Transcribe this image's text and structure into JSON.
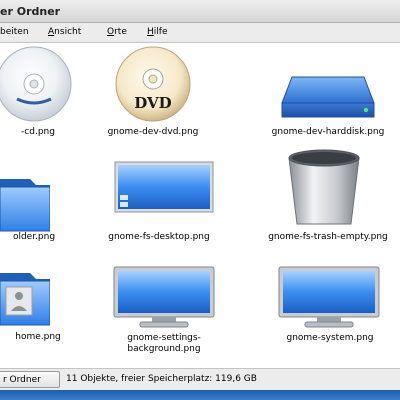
{
  "window": {
    "title": "er Ordner"
  },
  "menu": [
    {
      "label": "beiten",
      "underline": ""
    },
    {
      "label": "Ansicht",
      "underline": "A"
    },
    {
      "label": "Orte",
      "underline": "O"
    },
    {
      "label": "Hilfe",
      "underline": "H"
    }
  ],
  "files": [
    {
      "name": "-cd.png",
      "icon": "cd-disc-icon"
    },
    {
      "name": "gnome-dev-dvd.png",
      "icon": "dvd-disc-icon",
      "disc_text": "DVD"
    },
    {
      "name": "gnome-dev-harddisk.png",
      "icon": "harddisk-icon"
    },
    {
      "name": "older.png",
      "icon": "folder-icon"
    },
    {
      "name": "gnome-fs-desktop.png",
      "icon": "desktop-icon"
    },
    {
      "name": "gnome-fs-trash-empty.png",
      "icon": "trash-icon"
    },
    {
      "name": "home.png",
      "icon": "home-folder-icon"
    },
    {
      "name_line1": "gnome-settings-",
      "name_line2": "background.png",
      "icon": "monitor-background-icon"
    },
    {
      "name": "gnome-system.png",
      "icon": "monitor-icon"
    }
  ],
  "statusbar": {
    "location": "r Ordner",
    "info": "11 Objekte, freier Speicherplatz: 119,6 GB"
  },
  "colors": {
    "accent_blue": "#2f7fe6",
    "titlebar": "#dedede"
  }
}
